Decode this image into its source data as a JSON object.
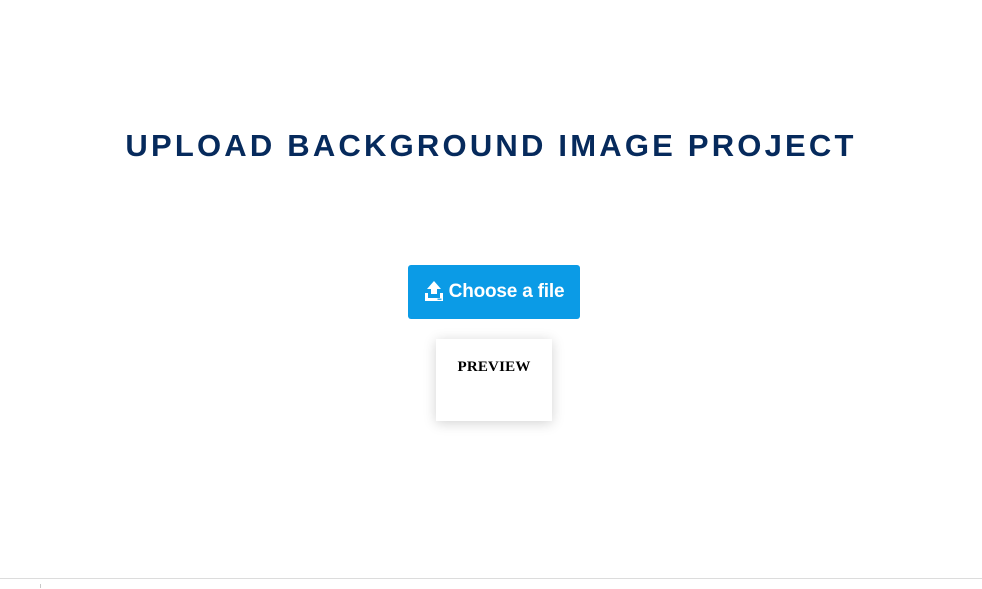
{
  "page": {
    "title": "UPLOAD BACKGROUND IMAGE PROJECT"
  },
  "upload": {
    "button_label": "Choose a file",
    "icon": "upload-icon",
    "color": "#0b9be6"
  },
  "preview": {
    "label": "PREVIEW"
  },
  "colors": {
    "title": "#062a5c",
    "background": "#ffffff"
  }
}
